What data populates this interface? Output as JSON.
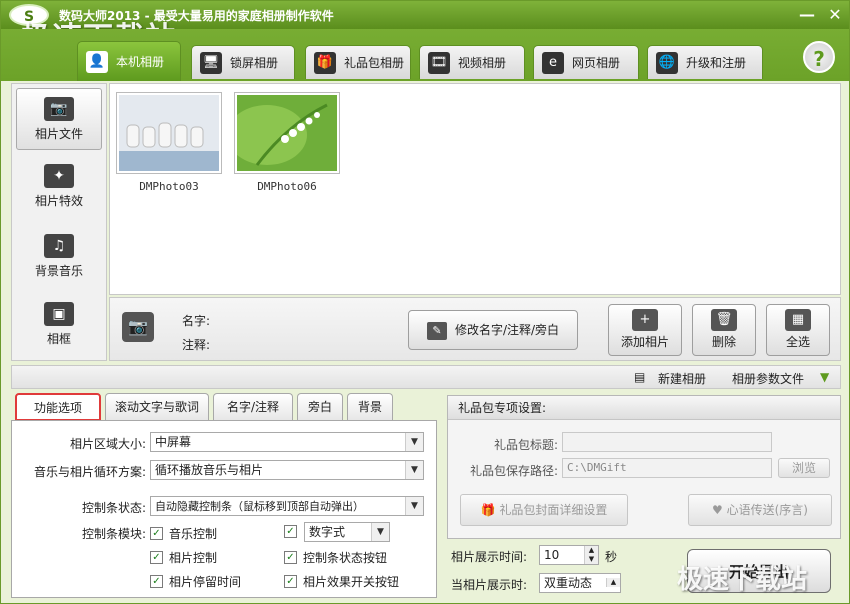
{
  "app": {
    "logo_text": "S",
    "title": "数码大师2013 - 最受大量易用的家庭相册制作软件",
    "watermark": "极速下载站",
    "watermark_bottom": "极速下载站"
  },
  "window_controls": {
    "minimize": "—",
    "close": "✕"
  },
  "tabs": [
    {
      "label": "本机相册",
      "icon": "👤"
    },
    {
      "label": "锁屏相册",
      "icon": "🖥"
    },
    {
      "label": "礼品包相册",
      "icon": "🎁"
    },
    {
      "label": "视频相册",
      "icon": "🎞"
    },
    {
      "label": "网页相册",
      "icon": "e"
    },
    {
      "label": "升级和注册",
      "icon": "🌐"
    }
  ],
  "help_label": "?",
  "sidebar": {
    "items": [
      {
        "label": "相片文件",
        "icon": "📷"
      },
      {
        "label": "相片特效",
        "icon": "✦"
      },
      {
        "label": "背景音乐",
        "icon": "♫"
      },
      {
        "label": "相框",
        "icon": "▣"
      }
    ]
  },
  "photos": [
    {
      "caption": "DMPhoto03"
    },
    {
      "caption": "DMPhoto06"
    }
  ],
  "photo_info": {
    "name_label": "名字:",
    "note_label": "注释:",
    "edit_button": "修改名字/注释/旁白",
    "add_button": "添加相片",
    "delete_button": "删除",
    "select_all_button": "全选"
  },
  "mid_strip": {
    "new_album": "新建相册",
    "params_file": "相册参数文件"
  },
  "sub_tabs": [
    "功能选项",
    "滚动文字与歌词",
    "名字/注释",
    "旁白",
    "背景"
  ],
  "options": {
    "area_size_label": "相片区域大小:",
    "area_size_value": "中屏幕",
    "loop_label": "音乐与相片循环方案:",
    "loop_value": "循环播放音乐与相片",
    "bar_state_label": "控制条状态:",
    "bar_state_value": "自动隐藏控制条（鼠标移到顶部自动弹出）",
    "bar_module_label": "控制条模块:",
    "checks": [
      {
        "label": "音乐控制",
        "checked": "✓"
      },
      {
        "label": "相片控制",
        "checked": "✓"
      },
      {
        "label": "相片停留时间",
        "checked": "✓"
      },
      {
        "label": "控制条状态按钮",
        "checked": "✓"
      },
      {
        "label": "相片效果开关按钮",
        "checked": "✓"
      }
    ],
    "digital_check": "✓",
    "digital_value": "数字式"
  },
  "gift": {
    "header": "礼品包专项设置:",
    "title_label": "礼品包标题:",
    "title_value": "",
    "path_label": "礼品包保存路径:",
    "path_value": "C:\\DMGift",
    "browse_button": "浏览",
    "cover_button": "礼品包封面详细设置",
    "heart_button": "心语传送(序言)"
  },
  "playback": {
    "show_time_label": "相片展示时间:",
    "show_time_value": "10",
    "seconds_unit": "秒",
    "when_show_label": "当相片展示时:",
    "when_show_value": "双重动态"
  },
  "start_button": "开始导出"
}
